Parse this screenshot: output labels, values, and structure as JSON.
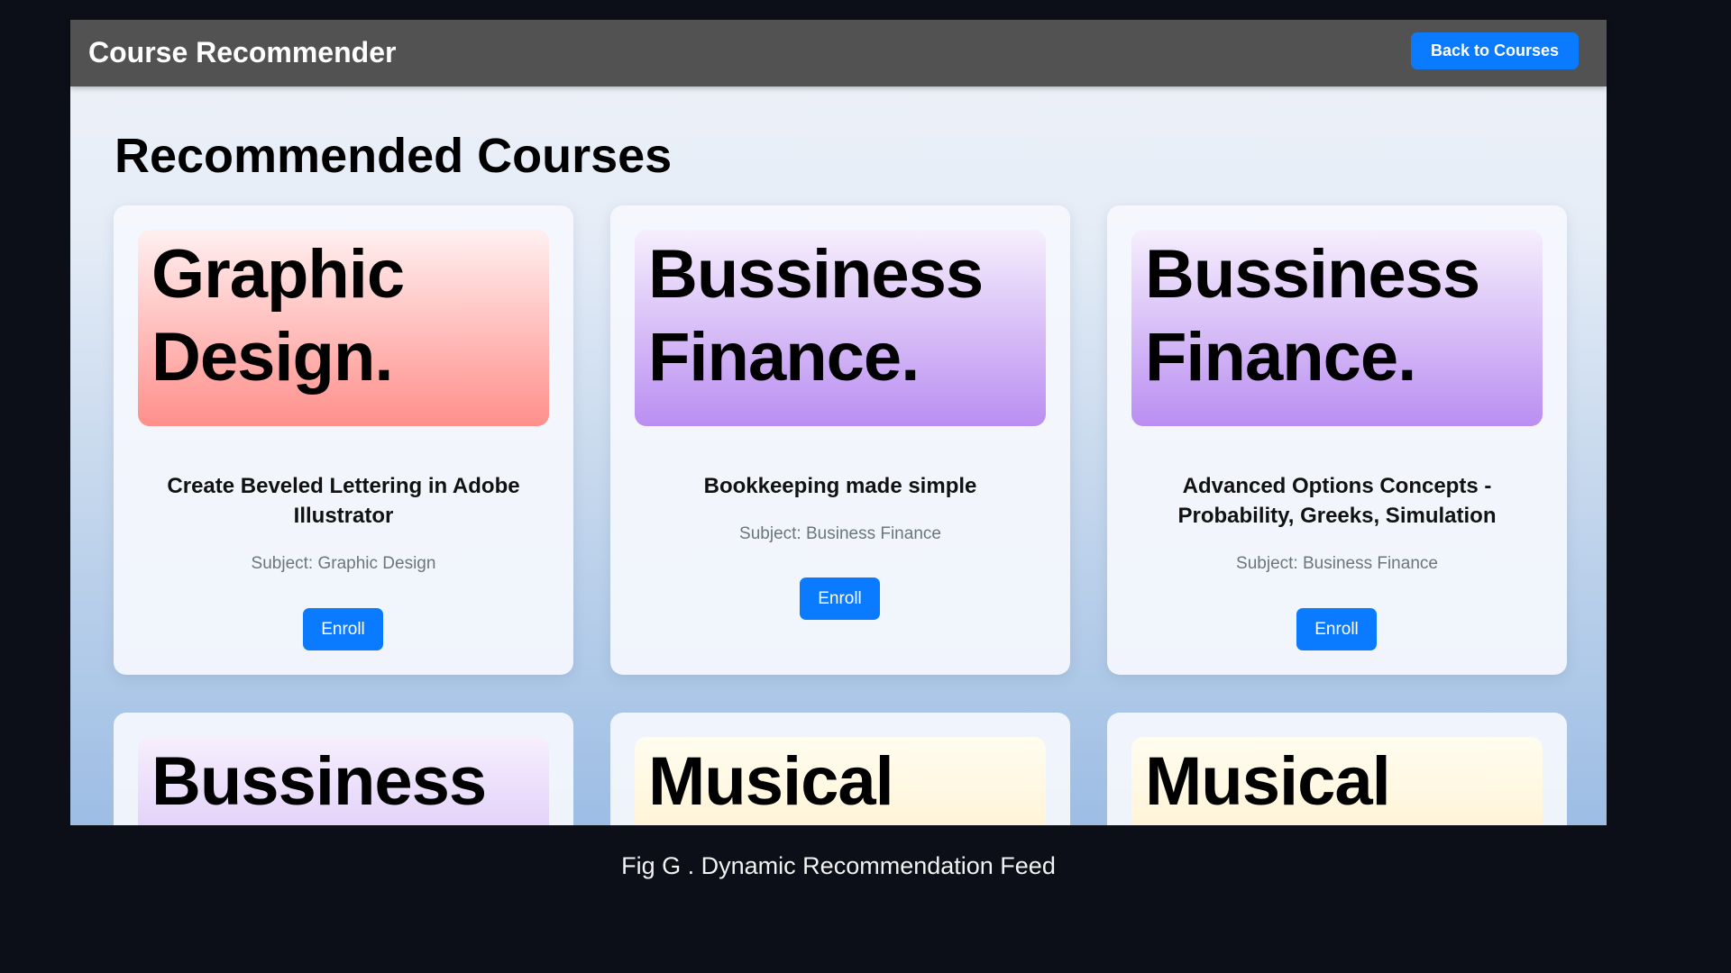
{
  "header": {
    "title": "Course Recommender",
    "back_button": "Back to Courses"
  },
  "page_title": "Recommended Courses",
  "courses": [
    {
      "banner": "Graphic Design.",
      "title": "Create Beveled Lettering in Adobe Illustrator",
      "subject": "Subject: Graphic Design",
      "enroll": "Enroll",
      "color": "#ff8f8b"
    },
    {
      "banner": "Bussiness Finance.",
      "title": "Bookkeeping made simple",
      "subject": "Subject: Business Finance",
      "enroll": "Enroll",
      "color": "#ba8ef1"
    },
    {
      "banner": "Bussiness Finance.",
      "title": "Advanced Options Concepts - Probability, Greeks, Simulation",
      "subject": "Subject: Business Finance",
      "enroll": "Enroll",
      "color": "#ba8ef1"
    },
    {
      "banner": "Bussiness"
    },
    {
      "banner": "Musical"
    },
    {
      "banner": "Musical"
    }
  ],
  "caption": "Fig G . Dynamic Recommendation Feed",
  "colors": {
    "accent": "#0a7bff",
    "header": "#525252"
  }
}
